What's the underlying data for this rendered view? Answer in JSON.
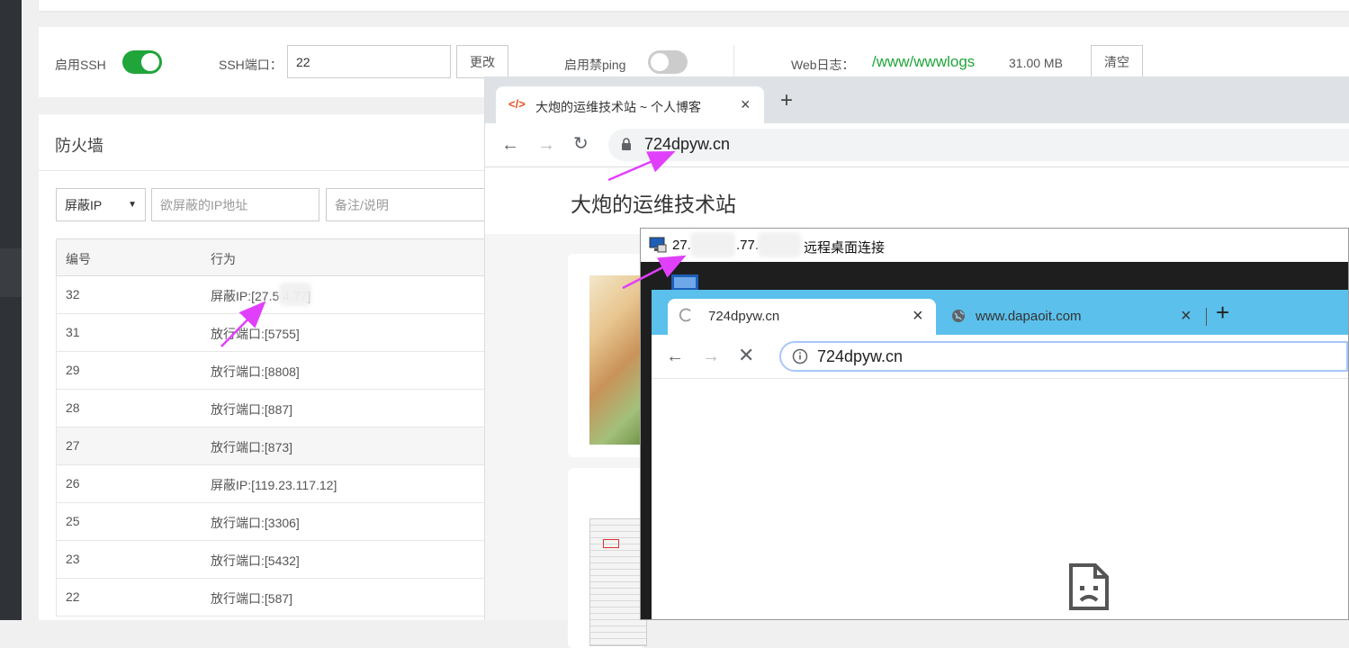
{
  "ssh": {
    "enable_ssh_label": "启用SSH",
    "ssh_port_label": "SSH端口：",
    "ssh_port_value": "22",
    "change_button": "更改",
    "disable_ping_label": "启用禁ping",
    "weblog_label": "Web日志：",
    "weblog_path": "/www/wwwlogs",
    "weblog_size": "31.00 MB",
    "clear_button": "清空",
    "ssh_enabled": true,
    "disable_ping_enabled": false
  },
  "firewall": {
    "title": "防火墙",
    "action_select": "屏蔽IP",
    "ip_placeholder": "欲屏蔽的IP地址",
    "note_placeholder": "备注/说明",
    "columns": [
      "编号",
      "行为"
    ],
    "rows": [
      {
        "id": "32",
        "action": "屏蔽IP:[27.5    4.77]"
      },
      {
        "id": "31",
        "action": "放行端口:[5755]"
      },
      {
        "id": "29",
        "action": "放行端口:[8808]"
      },
      {
        "id": "28",
        "action": "放行端口:[887]"
      },
      {
        "id": "27",
        "action": "放行端口:[873]"
      },
      {
        "id": "26",
        "action": "屏蔽IP:[119.23.117.12]"
      },
      {
        "id": "25",
        "action": "放行端口:[3306]"
      },
      {
        "id": "23",
        "action": "放行端口:[5432]"
      },
      {
        "id": "22",
        "action": "放行端口:[587]"
      }
    ]
  },
  "browser": {
    "tab_icon": "code-icon",
    "tab_title": "大炮的运维技术站 ~ 个人博客",
    "url": "724dpyw.cn",
    "site_title": "大炮的运维技术站"
  },
  "rdp": {
    "title_prefix": "27.",
    "title_mid": ".77.",
    "title_suffix": "远程桌面连接",
    "tabs": [
      {
        "title": "724dpyw.cn",
        "icon": "loading-icon"
      },
      {
        "title": "www.dapaoit.com",
        "icon": "globe-icon"
      }
    ],
    "url": "724dpyw.cn"
  },
  "colors": {
    "accent_green": "#20a53a",
    "arrow_magenta": "#e040fb",
    "rdp_tabstrip": "#5bc0eb"
  }
}
